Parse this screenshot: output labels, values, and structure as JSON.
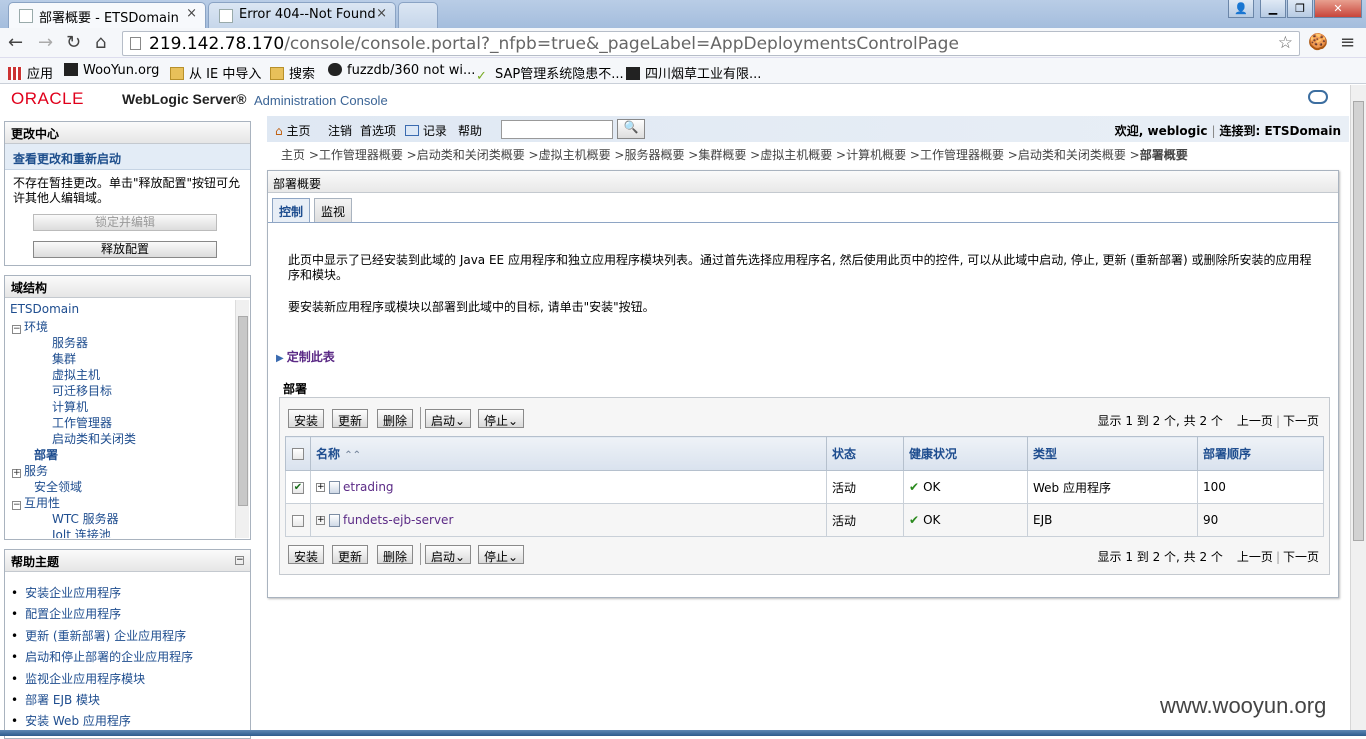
{
  "browser": {
    "tabs": [
      {
        "title": "部署概要 - ETSDomain",
        "close": "×"
      },
      {
        "title": "Error 404--Not Found",
        "close": "×"
      }
    ],
    "url_host": "219.142.78.170",
    "url_path": "/console/console.portal?_nfpb=true&_pageLabel=AppDeploymentsControlPage",
    "bookmarks": [
      "应用",
      "WooYun.org",
      "从 IE 中导入",
      "搜索",
      "fuzzdb/360 not wi...",
      "SAP管理系统隐患不...",
      "四川烟草工业有限..."
    ]
  },
  "header": {
    "logo": "ORACLE",
    "product": "WebLogic Server®",
    "subtitle": "Administration Console"
  },
  "change_center": {
    "title": "更改中心",
    "subtitle": "查看更改和重新启动",
    "text": "不存在暂挂更改。单击\"释放配置\"按钮可允许其他人编辑域。",
    "lock_button": "锁定并编辑",
    "release_button": "释放配置"
  },
  "domain_structure": {
    "title": "域结构",
    "root": "ETSDomain",
    "env": "环境",
    "env_items": [
      "服务器",
      "集群",
      "虚拟主机",
      "可迁移目标",
      "计算机",
      "工作管理器",
      "启动类和关闭类"
    ],
    "deploy": "部署",
    "services": "服务",
    "security": "安全领域",
    "interop": "互用性",
    "interop_items": [
      "WTC 服务器",
      "Jolt 连接池"
    ]
  },
  "help_topics": {
    "title": "帮助主题",
    "items": [
      "安装企业应用程序",
      "配置企业应用程序",
      "更新 (重新部署) 企业应用程序",
      "启动和停止部署的企业应用程序",
      "监视企业应用程序模块",
      "部署 EJB 模块",
      "安装 Web 应用程序"
    ]
  },
  "menubar": {
    "home": "主页",
    "logout": "注销",
    "prefs": "首选项",
    "record": "记录",
    "help": "帮助",
    "welcome": "欢迎, weblogic",
    "connected": "连接到: ETSDomain"
  },
  "breadcrumb": {
    "path": "主页 >工作管理器概要 >启动类和关闭类概要 >虚拟主机概要 >服务器概要 >集群概要 >虚拟主机概要 >计算机概要 >工作管理器概要 >启动类和关闭类概要 >",
    "current": "部署概要"
  },
  "content": {
    "title": "部署概要",
    "tabs": [
      "控制",
      "监视"
    ],
    "desc1": "此页中显示了已经安装到此域的 Java EE 应用程序和独立应用程序模块列表。通过首先选择应用程序名, 然后使用此页中的控件, 可以从此域中启动, 停止, 更新 (重新部署) 或删除所安装的应用程序和模块。",
    "desc2": "要安装新应用程序或模块以部署到此域中的目标, 请单击\"安装\"按钮。",
    "customize": "定制此表",
    "deploy_title": "部署"
  },
  "toolbar": {
    "install": "安装",
    "update": "更新",
    "delete": "删除",
    "start": "启动",
    "stop": "停止",
    "paging": "显示 1 到 2 个, 共 2 个",
    "prev": "上一页",
    "next": "下一页"
  },
  "table": {
    "headers": [
      "名称",
      "状态",
      "健康状况",
      "类型",
      "部署顺序"
    ],
    "rows": [
      {
        "name": "etrading",
        "state": "活动",
        "health": "OK",
        "type": "Web 应用程序",
        "order": "100",
        "checked": true
      },
      {
        "name": "fundets-ejb-server",
        "state": "活动",
        "health": "OK",
        "type": "EJB",
        "order": "90",
        "checked": false
      }
    ]
  },
  "watermark": "www.wooyun.org",
  "colors": {
    "oracle_red": "#e0001b",
    "link_blue": "#1e4d8f",
    "visited_purple": "#5b2a86"
  }
}
